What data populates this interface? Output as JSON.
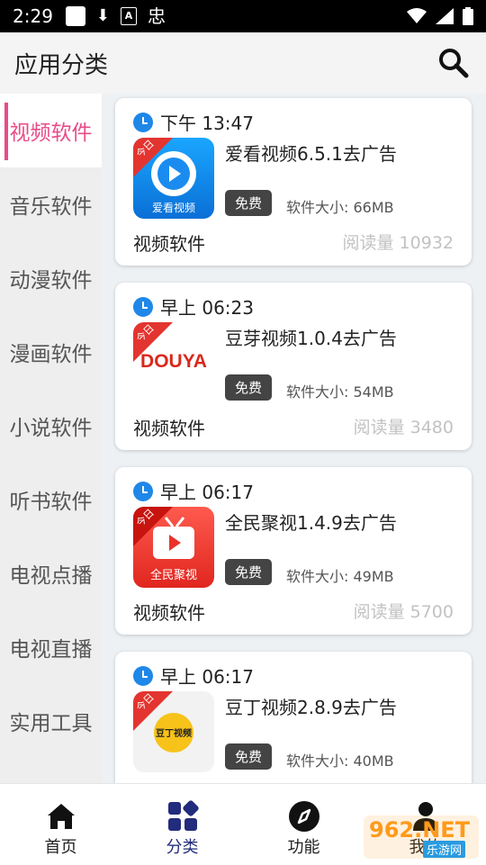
{
  "status_bar": {
    "time": "2:29"
  },
  "header": {
    "title": "应用分类",
    "search_icon": "search-icon"
  },
  "sidebar": {
    "items": [
      {
        "label": "视频软件",
        "active": true
      },
      {
        "label": "音乐软件"
      },
      {
        "label": "动漫软件"
      },
      {
        "label": "漫画软件"
      },
      {
        "label": "小说软件"
      },
      {
        "label": "听书软件"
      },
      {
        "label": "电视点播"
      },
      {
        "label": "电视直播"
      },
      {
        "label": "实用工具"
      }
    ],
    "active_color": "#e94b88"
  },
  "cards": [
    {
      "time": "下午 13:47",
      "name": "爱看视频6.5.1去广告",
      "badge": "免费",
      "size": "软件大小: 66MB",
      "category": "视频软件",
      "reads": "阅读量 10932",
      "thumb_caption": "爱看视频",
      "ribbon": "今日"
    },
    {
      "time": "早上 06:23",
      "name": "豆芽视频1.0.4去广告",
      "badge": "免费",
      "size": "软件大小: 54MB",
      "category": "视频软件",
      "reads": "阅读量 3480",
      "thumb_caption": "DOUYA",
      "ribbon": "今日"
    },
    {
      "time": "早上 06:17",
      "name": "全民聚视1.4.9去广告",
      "badge": "免费",
      "size": "软件大小: 49MB",
      "category": "视频软件",
      "reads": "阅读量 5700",
      "thumb_caption": "全民聚视",
      "ribbon": "今日"
    },
    {
      "time": "早上 06:17",
      "name": "豆丁视频2.8.9去广告",
      "badge": "免费",
      "size": "软件大小: 40MB",
      "category": "视频软件",
      "reads": "",
      "thumb_caption": "豆丁视频",
      "ribbon": "今日"
    }
  ],
  "bottom_nav": {
    "tabs": [
      {
        "label": "首页",
        "icon": "home-icon"
      },
      {
        "label": "分类",
        "icon": "grid-icon",
        "active": true
      },
      {
        "label": "功能",
        "icon": "compass-icon"
      },
      {
        "label": "我的",
        "icon": "person-icon"
      }
    ],
    "active_color": "#222c7c"
  },
  "watermark": {
    "text": "962.NET",
    "sub": "乐游网"
  }
}
